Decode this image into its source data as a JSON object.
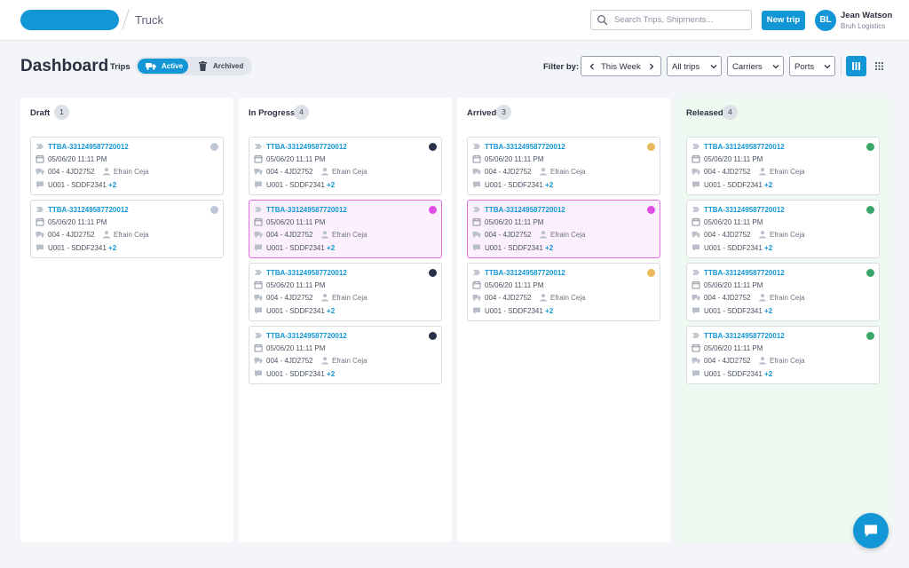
{
  "header": {
    "breadcrumb": "Truck",
    "search_placeholder": "Search Trips, Shipments...",
    "new_trip_label": "New trip",
    "user": {
      "initials": "BL",
      "name": "Jean Watson",
      "org": "Bruh Logistics"
    }
  },
  "page": {
    "title": "Dashboard",
    "trips_label": "Trips",
    "toggle": {
      "active": "Active",
      "archived": "Archived"
    },
    "filter_label": "Filter by:",
    "filters": {
      "week": "This Week",
      "trips": "All trips",
      "carriers": "Carriers",
      "ports": "Ports"
    }
  },
  "colors": {
    "accent": "#1296d6",
    "draft_dot": "#bfc6d9",
    "progress_dot": "#27324a",
    "arrived_dot": "#ebb95b",
    "released_dot": "#3aa769",
    "highlight_dot": "#e14be6"
  },
  "columns": [
    {
      "title": "Draft",
      "count": "1",
      "cards": [
        {
          "id": "TTBA-331249587720012",
          "date": "05/06/20 11:11 PM",
          "truck": "004 - 4JD2752",
          "driver": "Efrain Ceja",
          "unit": "U001 - SDDF2341",
          "extra": "+2",
          "status": "draft",
          "highlight": false
        },
        {
          "id": "TTBA-331249587720012",
          "date": "05/06/20 11:11 PM",
          "truck": "004 - 4JD2752",
          "driver": "Efrain Ceja",
          "unit": "U001 - SDDF2341",
          "extra": "+2",
          "status": "draft",
          "highlight": false
        }
      ]
    },
    {
      "title": "In Progress",
      "count": "4",
      "cards": [
        {
          "id": "TTBA-331249587720012",
          "date": "05/06/20 11:11 PM",
          "truck": "004 - 4JD2752",
          "driver": "Efrain Ceja",
          "unit": "U001 - SDDF2341",
          "extra": "+2",
          "status": "progress",
          "highlight": false
        },
        {
          "id": "TTBA-331249587720012",
          "date": "05/06/20 11:11 PM",
          "truck": "004 - 4JD2752",
          "driver": "Efrain Ceja",
          "unit": "U001 - SDDF2341",
          "extra": "+2",
          "status": "highlight",
          "highlight": true
        },
        {
          "id": "TTBA-331249587720012",
          "date": "05/06/20 11:11 PM",
          "truck": "004 - 4JD2752",
          "driver": "Efrain Ceja",
          "unit": "U001 - SDDF2341",
          "extra": "+2",
          "status": "progress",
          "highlight": false
        },
        {
          "id": "TTBA-331249587720012",
          "date": "05/06/20 11:11 PM",
          "truck": "004 - 4JD2752",
          "driver": "Efrain Ceja",
          "unit": "U001 - SDDF2341",
          "extra": "+2",
          "status": "progress",
          "highlight": false
        }
      ]
    },
    {
      "title": "Arrived",
      "count": "3",
      "cards": [
        {
          "id": "TTBA-331249587720012",
          "date": "05/06/20 11:11 PM",
          "truck": "004 - 4JD2752",
          "driver": "Efrain Ceja",
          "unit": "U001 - SDDF2341",
          "extra": "+2",
          "status": "arrived",
          "highlight": false
        },
        {
          "id": "TTBA-331249587720012",
          "date": "05/06/20 11:11 PM",
          "truck": "004 - 4JD2752",
          "driver": "Efrain Ceja",
          "unit": "U001 - SDDF2341",
          "extra": "+2",
          "status": "highlight",
          "highlight": true
        },
        {
          "id": "TTBA-331249587720012",
          "date": "05/06/20 11:11 PM",
          "truck": "004 - 4JD2752",
          "driver": "Efrain Ceja",
          "unit": "U001 - SDDF2341",
          "extra": "+2",
          "status": "arrived",
          "highlight": false
        }
      ]
    },
    {
      "title": "Released",
      "count": "4",
      "cards": [
        {
          "id": "TTBA-331249587720012",
          "date": "05/06/20 11:11 PM",
          "truck": "004 - 4JD2752",
          "driver": "Efrain Ceja",
          "unit": "U001 - SDDF2341",
          "extra": "+2",
          "status": "released",
          "highlight": false
        },
        {
          "id": "TTBA-331249587720012",
          "date": "05/06/20 11:11 PM",
          "truck": "004 - 4JD2752",
          "driver": "Efrain Ceja",
          "unit": "U001 - SDDF2341",
          "extra": "+2",
          "status": "released",
          "highlight": false
        },
        {
          "id": "TTBA-331249587720012",
          "date": "05/06/20 11:11 PM",
          "truck": "004 - 4JD2752",
          "driver": "Efrain Ceja",
          "unit": "U001 - SDDF2341",
          "extra": "+2",
          "status": "released",
          "highlight": false
        },
        {
          "id": "TTBA-331249587720012",
          "date": "05/06/20 11:11 PM",
          "truck": "004 - 4JD2752",
          "driver": "Efrain Ceja",
          "unit": "U001 - SDDF2341",
          "extra": "+2",
          "status": "released",
          "highlight": false
        }
      ]
    }
  ]
}
